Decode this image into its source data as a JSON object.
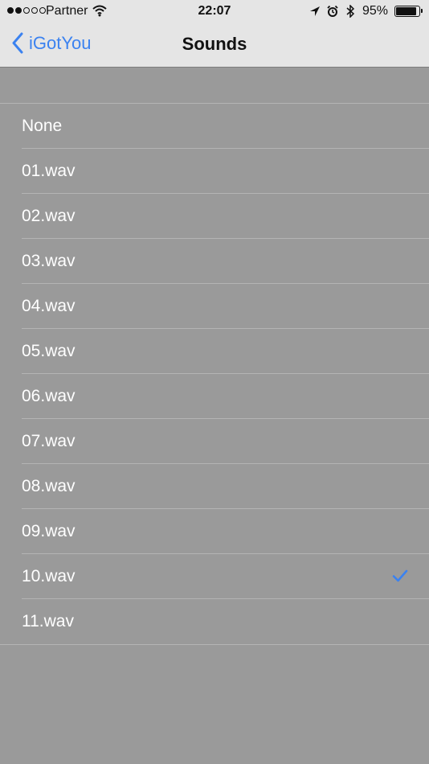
{
  "status_bar": {
    "signal_filled": 2,
    "signal_total": 5,
    "carrier": "Partner",
    "time": "22:07",
    "battery_text": "95%",
    "battery_level": 0.95
  },
  "nav": {
    "back_label": "iGotYou",
    "title": "Sounds"
  },
  "sounds": [
    {
      "label": "None",
      "selected": false
    },
    {
      "label": "01.wav",
      "selected": false
    },
    {
      "label": "02.wav",
      "selected": false
    },
    {
      "label": "03.wav",
      "selected": false
    },
    {
      "label": "04.wav",
      "selected": false
    },
    {
      "label": "05.wav",
      "selected": false
    },
    {
      "label": "06.wav",
      "selected": false
    },
    {
      "label": "07.wav",
      "selected": false
    },
    {
      "label": "08.wav",
      "selected": false
    },
    {
      "label": "09.wav",
      "selected": false
    },
    {
      "label": "10.wav",
      "selected": true
    },
    {
      "label": "11.wav",
      "selected": false
    }
  ],
  "colors": {
    "accent": "#3b82f0",
    "background": "#9a9a9a",
    "header": "#e5e5e5",
    "separator": "#b4b4b4"
  }
}
